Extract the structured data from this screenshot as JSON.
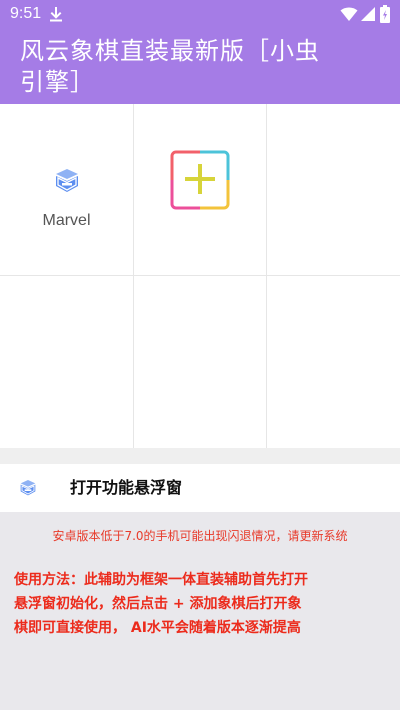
{
  "status_bar": {
    "time": "9:51",
    "icons": [
      "download-icon",
      "wifi-icon",
      "signal-icon",
      "battery-icon"
    ]
  },
  "header": {
    "title": "风云象棋直装最新版［小虫引擎］",
    "background_color": "#a57ce6"
  },
  "apps": [
    {
      "label": "Marvel",
      "icon": "marvel-icon"
    },
    {
      "label": "",
      "icon": "add-icon"
    }
  ],
  "float_window": {
    "label": "打开功能悬浮窗",
    "icon": "marvel-icon"
  },
  "notice": {
    "warning": "安卓版本低于7.0的手机可能出现闪退情况，请更新系统",
    "usage": "使用方法：此辅助为框架一体直装辅助首先打开悬浮窗初始化，然后点击 + 添加象棋后打开象棋即可直接使用，  AI水平会随着版本逐渐提高",
    "text_color": "#ec2b1c"
  }
}
